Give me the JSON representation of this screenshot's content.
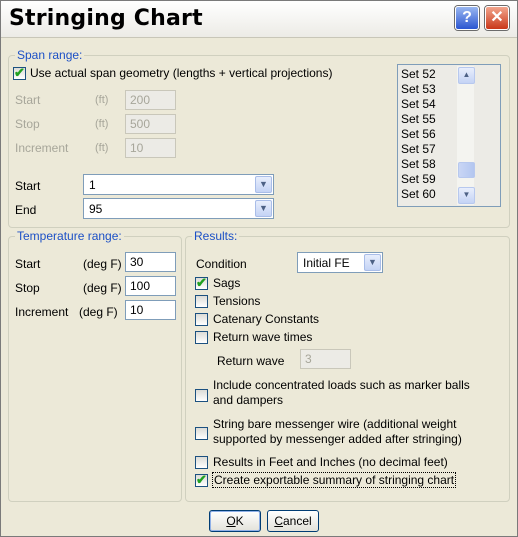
{
  "window": {
    "title": "Stringing Chart",
    "help_label": "?",
    "close_label": "✕"
  },
  "span_range": {
    "legend": "Span range:",
    "use_actual_geometry": {
      "label": "Use actual span geometry (lengths + vertical projections)",
      "checked": true
    },
    "start": {
      "label": "Start",
      "unit": "(ft)",
      "value": "200"
    },
    "stop": {
      "label": "Stop",
      "unit": "(ft)",
      "value": "500"
    },
    "increment": {
      "label": "Increment",
      "unit": "(ft)",
      "value": "10"
    },
    "start_combo": {
      "label": "Start",
      "value": "1"
    },
    "end_combo": {
      "label": "End",
      "value": "95"
    },
    "sets": [
      "Set 52",
      "Set 53",
      "Set 54",
      "Set 55",
      "Set 56",
      "Set 57",
      "Set 58",
      "Set 59",
      "Set 60"
    ]
  },
  "temperature_range": {
    "legend": "Temperature range:",
    "start": {
      "label": "Start",
      "unit": "(deg F)",
      "value": "30"
    },
    "stop": {
      "label": "Stop",
      "unit": "(deg F)",
      "value": "100"
    },
    "increment": {
      "label": "Increment",
      "unit": "(deg F)",
      "value": "10"
    }
  },
  "results": {
    "legend": "Results:",
    "condition_label": "Condition",
    "condition_value": "Initial FE",
    "sags": {
      "label": "Sags",
      "checked": true
    },
    "tensions": {
      "label": "Tensions",
      "checked": false
    },
    "catenary": {
      "label": "Catenary Constants",
      "checked": false
    },
    "return_wave_times": {
      "label": "Return wave times",
      "checked": false
    },
    "return_wave": {
      "label": "Return wave",
      "value": "3"
    },
    "include_loads": {
      "label_line1": "Include concentrated loads such as marker balls",
      "label_line2": "and dampers",
      "checked": false
    },
    "messenger": {
      "label_line1": "String bare messenger wire (additional weight",
      "label_line2": "supported by messenger added after stringing)",
      "checked": false
    },
    "feet_inches": {
      "label": "Results in Feet and Inches (no decimal feet)",
      "checked": false
    },
    "exportable": {
      "label": "Create exportable summary of stringing chart",
      "checked": true
    }
  },
  "buttons": {
    "ok_u": "O",
    "ok_rest": "K",
    "cancel_u": "C",
    "cancel_rest": "ancel"
  }
}
